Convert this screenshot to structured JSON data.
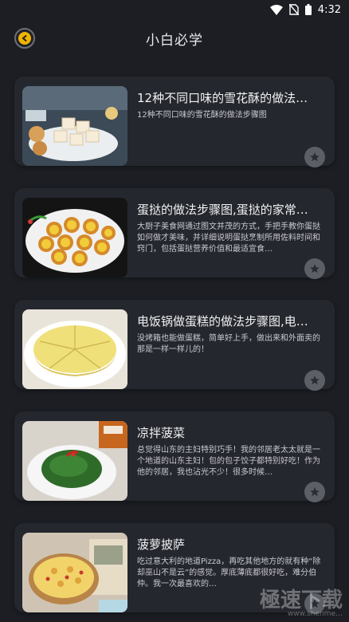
{
  "status": {
    "time": "4:32"
  },
  "header": {
    "title": "小白必学"
  },
  "recipes": [
    {
      "title": "12种不同口味的雪花酥的做法…",
      "desc": "12种不同口味的雪花酥的做法步骤图"
    },
    {
      "title": "蛋挞的做法步骤图,蛋挞的家常…",
      "desc": "大厨子美食网通过图文并茂的方式，手把手教你蛋挞如何做才美味，并详细说明蛋挞烹制所用佐料时间和窍门，包括蛋挞营养价值和最适宜食…"
    },
    {
      "title": "电饭锅做蛋糕的做法步骤图,电…",
      "desc": "没烤箱也能做蛋糕，简单好上手，做出来和外面卖的那是一样一样儿的！"
    },
    {
      "title": "凉拌菠菜",
      "desc": "总觉得山东的主妇特别巧手！我的邻居老太太就是一个地道的山东主妇！包的包子饺子都特别好吃！作为他的邻居，我也沾光不少！很多时候…"
    },
    {
      "title": "菠萝披萨",
      "desc": "吃过意大利的地道Pizza，再吃其他地方的就有种“除却巫山不是云”的感觉。厚底薄底都很好吃，难分伯仲。我一次最喜欢的…"
    }
  ],
  "watermark": {
    "text": "極速下载",
    "sub": "www.shenme…"
  }
}
